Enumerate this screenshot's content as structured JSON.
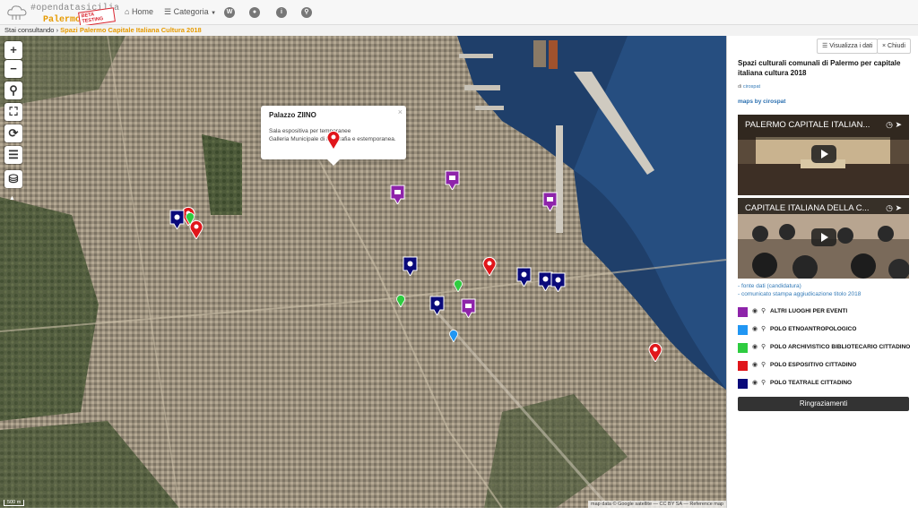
{
  "brand": {
    "name": "#opendatasicilia",
    "sub": "Palermo Hub",
    "badge": "BETA TESTING"
  },
  "nav": {
    "home": "Home",
    "categoria": "Categoria"
  },
  "nav_icons": [
    "wikipedia-icon",
    "github-icon",
    "info-icon",
    "search-icon"
  ],
  "breadcrumb": {
    "label": "Stai consultando",
    "current": "Spazi Palermo Capitale Italiana Cultura 2018"
  },
  "map": {
    "popup": {
      "title": "Palazzo ZIINO",
      "line1": "Sala espositiva per temporanee",
      "line2": "Galleria Municipale di fotografia e estemporanea."
    },
    "controls": {
      "zoom_in": "+",
      "zoom_out": "−"
    },
    "attribution": "map data © Google satellite — CC BY SA — Reference map",
    "scale": "500 m"
  },
  "panel": {
    "view_data_label": "Visualizza i dati",
    "close_label": "Chiudi",
    "title": "Spazi culturali comunali di Palermo per capitale italiana cultura 2018",
    "author_prefix": "di",
    "author": "cirospat",
    "maps_by": "maps by cirospat",
    "videos": [
      {
        "title": "PALERMO CAPITALE ITALIAN..."
      },
      {
        "title": "CAPITALE ITALIANA DELLA C..."
      }
    ],
    "links": [
      "- fonte dati (candidatura)",
      "- comunicato stampa aggiudicazione titolo 2018"
    ],
    "legend": [
      {
        "label": "ALTRI LUOGHI PER EVENTI",
        "color": "#8e24aa"
      },
      {
        "label": "POLO ETNOANTROPOLOGICO",
        "color": "#2196f3"
      },
      {
        "label": "POLO ARCHIVISTICO BIBLIOTECARIO CITTADINO",
        "color": "#2ecc40"
      },
      {
        "label": "POLO ESPOSITIVO CITTADINO",
        "color": "#e0161b"
      },
      {
        "label": "POLO TEATRALE CITTADINO",
        "color": "#0a0a7a"
      }
    ],
    "thanks_label": "Ringraziamenti"
  }
}
